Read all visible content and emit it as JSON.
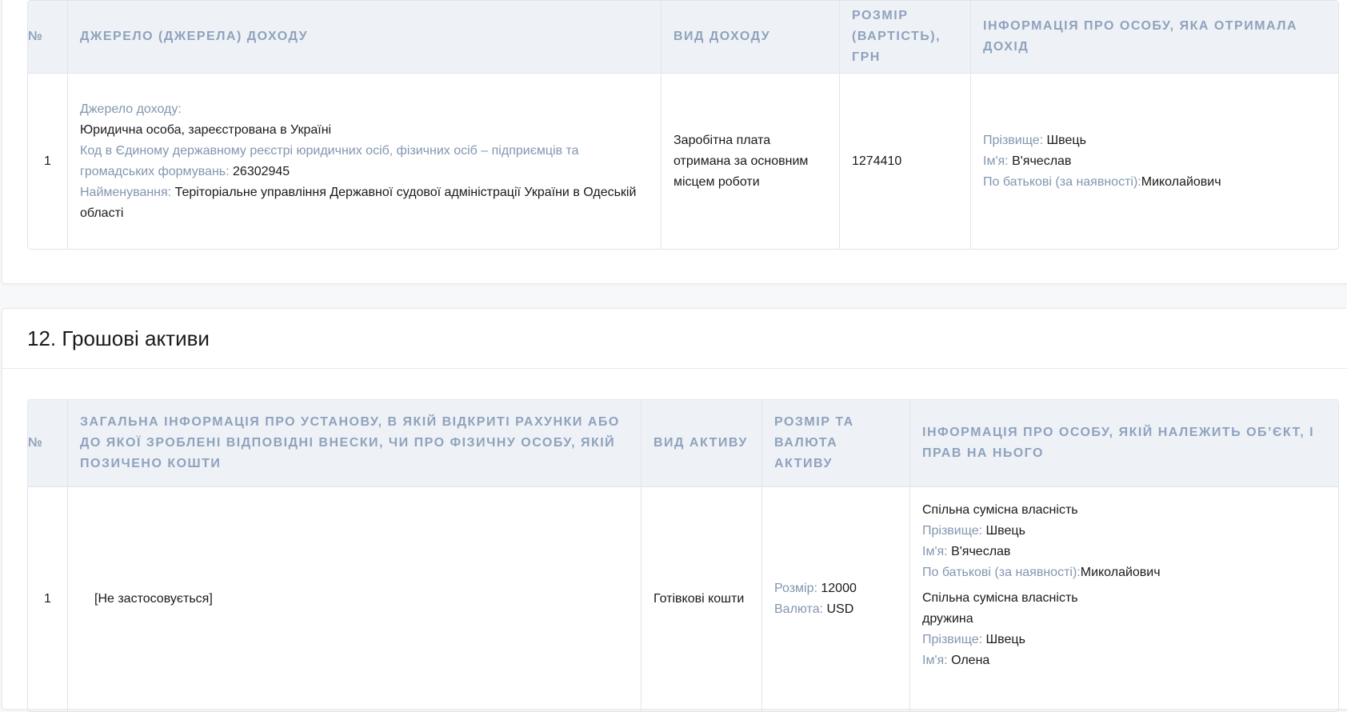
{
  "income_section": {
    "headers": {
      "num": "№",
      "source": "Джерело (джерела) доходу",
      "type": "Вид доходу",
      "amount": "Розмір (вартість), грн",
      "person": "Інформація про особу, яка отримала дохід"
    },
    "row": {
      "num": "1",
      "source_label": "Джерело доходу:",
      "source_value": "Юридична особа, зареєстрована в Україні",
      "code_label": "Код в Єдиному державному реєстрі юридичних осіб, фізичних осіб – підприємців та громадських формувань:",
      "code_value": "26302945",
      "name_label": "Найменування:",
      "name_value": "Теріторіальне управління Державної судової адміністрації України в Одеській області",
      "income_type": "Заробітна плата отримана за основним місцем роботи",
      "amount": "1274410",
      "surname_label": "Прізвище:",
      "surname": "Швець",
      "firstname_label": "Ім'я:",
      "firstname": "В'ячеслав",
      "patronymic_label": "По батькові (за наявності):",
      "patronymic": "Миколайович"
    }
  },
  "assets_section": {
    "title": "12. Грошові активи",
    "headers": {
      "num": "№",
      "institution": "Загальна інформація про установу, в якій відкриті рахунки або до якої зроблені відповідні внески, чи про фізичну особу, якій позичено кошти",
      "asset_type": "Вид активу",
      "amount_currency": "Розмір та валюта активу",
      "owner_info": "Інформація про особу, якій належить об’єкт, і прав на нього"
    },
    "row": {
      "num": "1",
      "institution": "[Не застосовується]",
      "asset_type": "Готівкові кошти",
      "amount_label": "Розмір:",
      "amount": "12000",
      "currency_label": "Валюта:",
      "currency": "USD",
      "owners": [
        {
          "ownership": "Спільна сумісна власність",
          "surname_label": "Прізвище:",
          "surname": "Швець",
          "firstname_label": "Ім'я:",
          "firstname": "В'ячеслав",
          "patronymic_label": "По батькові (за наявності):",
          "patronymic": "Миколайович"
        },
        {
          "ownership": "Спільна сумісна власність",
          "relation": "дружина",
          "surname_label": "Прізвище:",
          "surname": "Швець",
          "firstname_label": "Ім'я:",
          "firstname": "Олена"
        }
      ]
    }
  },
  "colors": {
    "header_bg": "#eef2f7",
    "header_text": "#8fa2bd",
    "label_text": "#8396b0",
    "value_text": "#1a1a1a",
    "border": "#e1e5ea"
  }
}
